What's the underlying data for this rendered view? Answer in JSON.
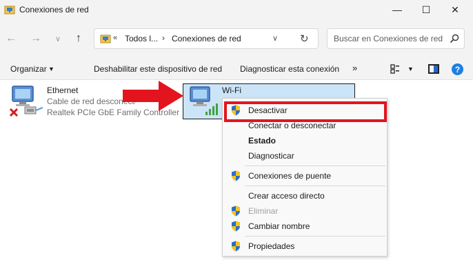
{
  "window": {
    "title": "Conexiones de red",
    "minimize_glyph": "—",
    "maximize_glyph": "☐",
    "close_glyph": "✕"
  },
  "nav": {
    "back_glyph": "←",
    "forward_glyph": "→",
    "recent_glyph": "∨",
    "up_glyph": "↑"
  },
  "address": {
    "overflow_glyph": "«",
    "crumb_1": "Todos l...",
    "separator": "›",
    "crumb_2": "Conexiones de red",
    "dropdown_glyph": "∨",
    "refresh_glyph": "↻"
  },
  "search": {
    "placeholder": "Buscar en Conexiones de red",
    "icon": "search-icon"
  },
  "commands": {
    "organize": "Organizar",
    "organize_arrow": "▼",
    "disable_device": "Deshabilitar este dispositivo de red",
    "diagnose": "Diagnosticar esta conexión",
    "more": "»",
    "view_arrow": "▼",
    "help": "?"
  },
  "adapters": [
    {
      "name": "Ethernet",
      "status": "Cable de red desconectado",
      "device": "Realtek PCIe GbE Family Controller",
      "icon": "ethernet-disconnected-icon"
    },
    {
      "name": "Wi-Fi",
      "icon": "wifi-adapter-icon"
    }
  ],
  "context_menu": {
    "items": [
      {
        "label": "Desactivar",
        "shield": true,
        "style": "normal"
      },
      {
        "label": "Conectar o desconectar",
        "shield": false,
        "style": "normal"
      },
      {
        "label": "Estado",
        "shield": false,
        "style": "bold"
      },
      {
        "label": "Diagnosticar",
        "shield": false,
        "style": "normal"
      },
      {
        "label": "Conexiones de puente",
        "shield": true,
        "style": "normal"
      },
      {
        "label": "Crear acceso directo",
        "shield": false,
        "style": "normal"
      },
      {
        "label": "Eliminar",
        "shield": true,
        "style": "disabled"
      },
      {
        "label": "Cambiar nombre",
        "shield": true,
        "style": "normal"
      },
      {
        "label": "Propiedades",
        "shield": true,
        "style": "normal"
      }
    ]
  },
  "colors": {
    "highlight_border": "#e3141e",
    "selection_bg": "#cce4f7",
    "arrow": "#e3141e"
  }
}
